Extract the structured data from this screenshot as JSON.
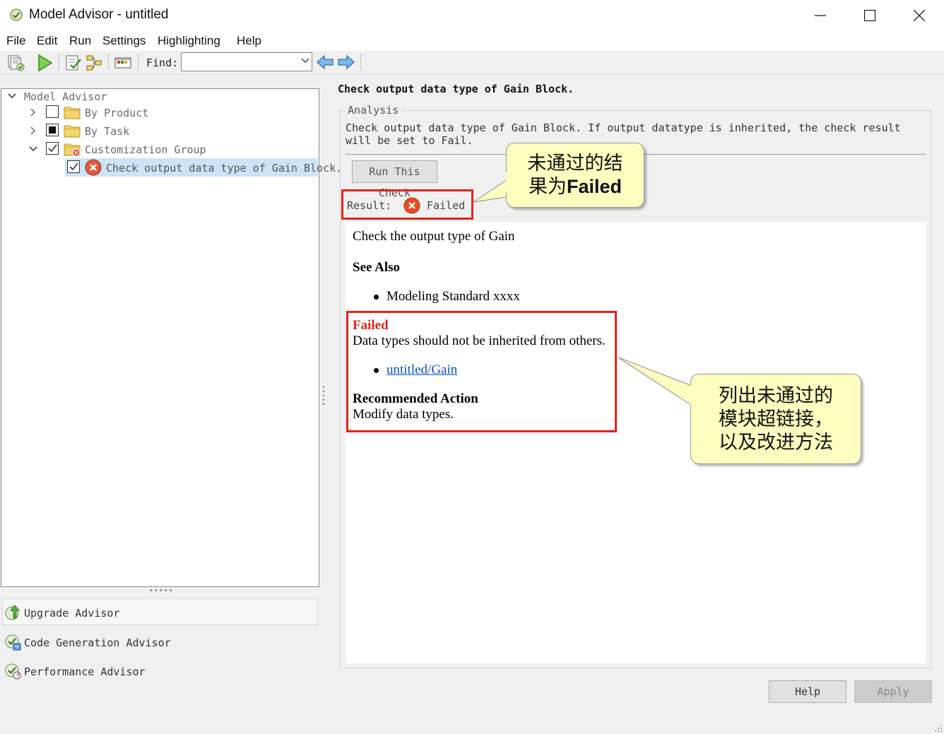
{
  "window": {
    "title": "Model Advisor - untitled",
    "icon": "model-advisor-check-icon"
  },
  "menu": [
    "File",
    "Edit",
    "Run",
    "Settings",
    "Highlighting",
    "Help"
  ],
  "toolbar": {
    "find_label": "Find:",
    "find_value": "",
    "icons": [
      "restore-defaults-icon",
      "run-checks-icon",
      "mark-check-icon",
      "highlight-icon",
      "report-icon",
      "back-arrow-icon",
      "forward-arrow-icon"
    ]
  },
  "tree": {
    "root": "Model Advisor",
    "items": [
      {
        "label": "By Product",
        "checkbox": "unchecked"
      },
      {
        "label": "By Task",
        "checkbox": "partial"
      },
      {
        "label": "Customization Group",
        "checkbox": "checked"
      },
      {
        "label": "Check output data type of Gain Block.",
        "checkbox": "checked",
        "status": "failed"
      }
    ]
  },
  "advisors": [
    "Upgrade Advisor",
    "Code Generation Advisor",
    "Performance Advisor"
  ],
  "check": {
    "title": "Check output data type of Gain Block.",
    "analysis_legend": "Analysis",
    "description": "Check output data type of Gain Block. If output datatype is inherited, the check result will be set to Fail.",
    "run_button": "Run This Check",
    "result_label": "Result:",
    "result_value": "Failed"
  },
  "report": {
    "intro": "Check the output type of Gain",
    "see_also_heading": "See Also",
    "see_also_items": [
      "Modeling Standard xxxx"
    ],
    "failed_heading": "Failed",
    "failed_message": "Data types should not be inherited from others.",
    "failed_link": "untitled/Gain",
    "recommended_heading": "Recommended Action",
    "recommended_text": "Modify data types."
  },
  "callouts": {
    "result_note_line1": "未通过的结",
    "result_note_line2": "果为",
    "result_note_bold": "Failed",
    "report_note_line1": "列出未通过的",
    "report_note_line2": "模块超链接，",
    "report_note_line3": "以及改进方法"
  },
  "buttons": {
    "help": "Help",
    "apply": "Apply"
  },
  "colors": {
    "failed_red": "#e2231a",
    "link_blue": "#0b51c5",
    "selection": "#cce4f7",
    "callout_bg": "#fffcc0"
  }
}
